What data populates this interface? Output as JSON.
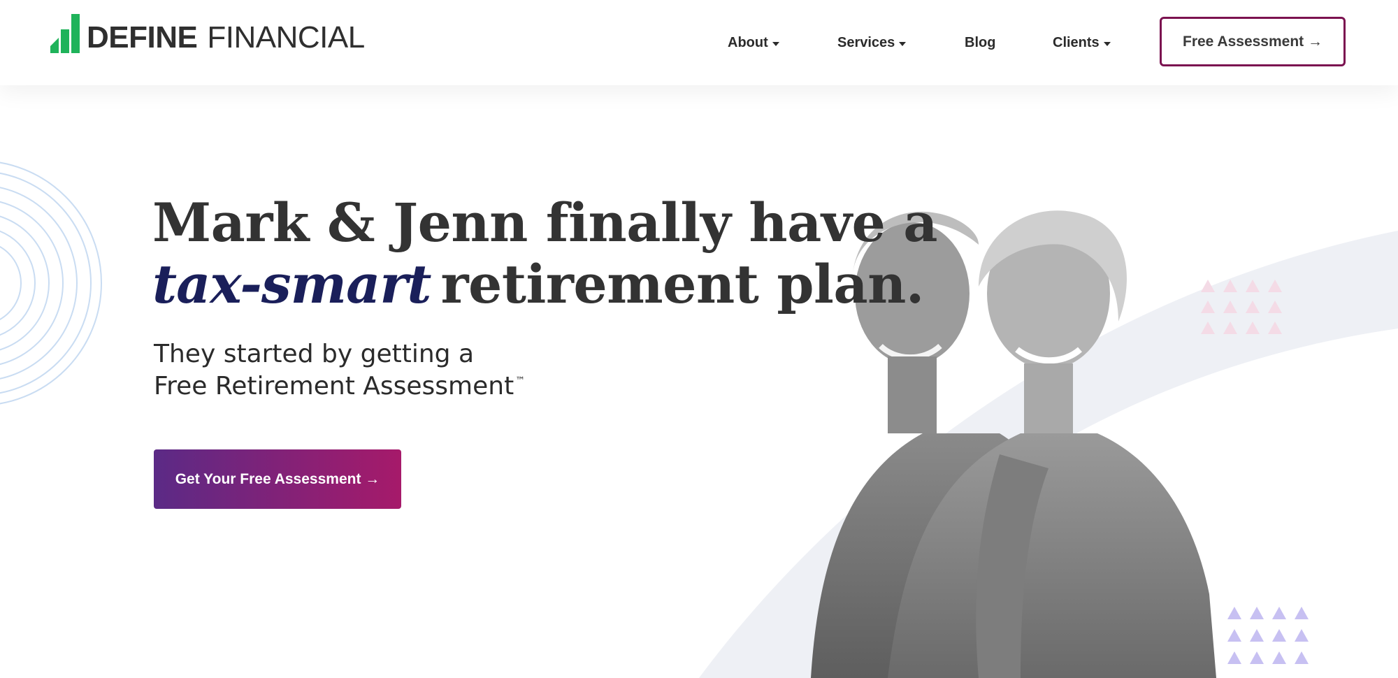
{
  "header": {
    "logo": {
      "bold": "DEFINE",
      "light": "FINANCIAL"
    },
    "nav": [
      {
        "label": "About",
        "dropdown": true
      },
      {
        "label": "Services",
        "dropdown": true
      },
      {
        "label": "Blog",
        "dropdown": false
      },
      {
        "label": "Clients",
        "dropdown": true
      }
    ],
    "cta": "Free Assessment →"
  },
  "hero": {
    "headline_line1": "Mark & Jenn finally have a",
    "headline_script": "tax-smart",
    "headline_rest": "retirement plan.",
    "sub_line1": "They started by getting a",
    "sub_line2": "Free Retirement Assessment",
    "trademark": "™",
    "cta": "Get Your Free Assessment →"
  },
  "colors": {
    "brand_green": "#1fb35a",
    "brand_purple": "#5b2a86",
    "brand_magenta": "#a61a6a",
    "outline_button": "#7b1250"
  },
  "icons": [
    "bar-chart-logo-icon",
    "caret-down-icon",
    "arrow-right-icon",
    "triangle-pattern-icon",
    "concentric-circles-icon"
  ]
}
